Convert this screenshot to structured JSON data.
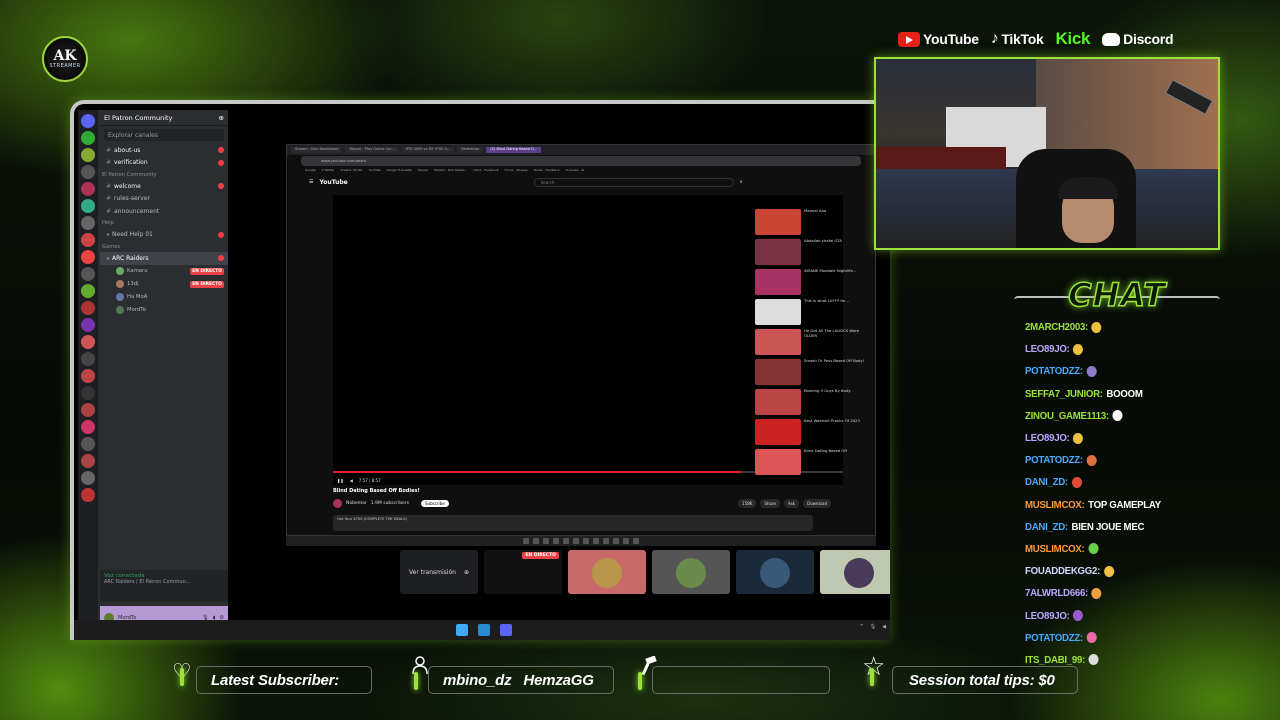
{
  "logo": {
    "mark": "AK",
    "sub": "STREAMER"
  },
  "socials": [
    {
      "name": "YouTube",
      "icon": "youtube-icon"
    },
    {
      "name": "TikTok",
      "icon": "tiktok-icon"
    },
    {
      "name": "Kick",
      "icon": "kick-icon"
    },
    {
      "name": "Discord",
      "icon": "discord-icon"
    }
  ],
  "discord": {
    "server_name": "El Patron Community",
    "search_placeholder": "Explorar canales",
    "channels": [
      {
        "label": "about-us",
        "badge": true,
        "bold": true
      },
      {
        "label": "verification",
        "badge": true,
        "bold": true
      }
    ],
    "category_community": "El Patron Community",
    "community_channels": [
      {
        "label": "welcome",
        "badge": true,
        "bold": true
      },
      {
        "label": "rules-server",
        "badge": false,
        "bold": false
      },
      {
        "label": "announcement",
        "badge": false,
        "bold": false
      }
    ],
    "category_help": "Help",
    "help_channels": [
      {
        "label": "Need Help 01",
        "badge": true
      }
    ],
    "category_games": "Games",
    "game_channel": "ARC Raiders",
    "voice_users": [
      {
        "name": "Kamaru",
        "live": "EN DIRECTO"
      },
      {
        "name": "13dj",
        "live": "EN DIRECTO"
      },
      {
        "name": "Ha MoA",
        "live": ""
      },
      {
        "name": "MordTo",
        "live": ""
      }
    ],
    "voice_connected": "Voz conectada",
    "voice_location": "ARC Raiders / El Patron Commun...",
    "username": "MordTo"
  },
  "browser": {
    "tabs": [
      "Stream - Kick Dashboard",
      "Rayuel - Play Online Cur...",
      "RTX 4090 vs RX 9700 X...",
      "Redirector",
      "(1) Blind Dating Based O..."
    ],
    "active_tab": 4,
    "url": "www.youtube.com/watch",
    "bookmarks": [
      "Google",
      "K Twitter",
      "Creator Studio",
      "YouTube",
      "Google Translate",
      "Rayuel",
      "Stream - Kick Dashb...",
      "Inbox - Facebook",
      "Home - Shopee",
      "Home - Feedback",
      "Surprise - AI"
    ],
    "yt_logo": "YouTube",
    "search_placeholder": "Search",
    "time": "7:57 / 8:57",
    "progress_fraction": 0.8,
    "video_title": "Blind Dating Based Off Bodies!",
    "channel": "Nobemar",
    "subscribers": "1.9M subscribers",
    "subscribe": "Subscribe",
    "actions": [
      "158K",
      "Share",
      "Ask",
      "Download"
    ],
    "description": "Get Your $750 (COMPLETE THE DEALS)",
    "recommendations": [
      {
        "title": "Manual Ana",
        "color": "#c43"
      },
      {
        "title": "Abdallah chafai GTA",
        "color": "#734"
      },
      {
        "title": "INSANE Modable Nightlife...",
        "color": "#a36"
      },
      {
        "title": "This is what LUFFY fm...",
        "color": "#ddd"
      },
      {
        "title": "He Got All The LAUGCS Wore OLDER",
        "color": "#c55"
      },
      {
        "title": "Smash Or Pass Based Off Body!",
        "color": "#833"
      },
      {
        "title": "Ranking 5 Guys By Body",
        "color": "#b44"
      },
      {
        "title": "Best Walmart Pranks Of 2023",
        "color": "#c22"
      },
      {
        "title": "Blind Dating Based Off",
        "color": "#d55"
      }
    ]
  },
  "strip": {
    "watch_label": "Ver transmisión",
    "live_label": "EN DIRECTO"
  },
  "chat": {
    "title": "CHAT",
    "messages": [
      {
        "user": "2MARCH2003:",
        "text": "",
        "color": "#9be33a",
        "emoji": "#f0c040"
      },
      {
        "user": "LEO89JO:",
        "text": "",
        "color": "#b9a6ff",
        "emoji": "#f0c040"
      },
      {
        "user": "POTATODZZ:",
        "text": "",
        "color": "#4aa8ff",
        "emoji": "#8a7cc8"
      },
      {
        "user": "SEFFA7_JUNIOR:",
        "text": "BOOOM",
        "color": "#9be33a",
        "emoji": ""
      },
      {
        "user": "ZINOU_GAME1113:",
        "text": "",
        "color": "#9be33a",
        "emoji": "#ffffff"
      },
      {
        "user": "LEO89JO:",
        "text": "",
        "color": "#b9a6ff",
        "emoji": "#f0c040"
      },
      {
        "user": "POTATODZZ:",
        "text": "",
        "color": "#4aa8ff",
        "emoji": "#e07040"
      },
      {
        "user": "DANI_ZD:",
        "text": "",
        "color": "#4aa8ff",
        "emoji": "#e04a3a"
      },
      {
        "user": "MUSLIMCOX:",
        "text": "TOP GAMEPLAY",
        "color": "#ff9a3a",
        "emoji": ""
      },
      {
        "user": "DANI_ZD:",
        "text": "BIEN JOUE MEC",
        "color": "#4aa8ff",
        "emoji": ""
      },
      {
        "user": "MUSLIMCOX:",
        "text": "",
        "color": "#ff9a3a",
        "emoji": "#6ad04a"
      },
      {
        "user": "FOUADDEKGG2:",
        "text": "",
        "color": "#cfd8ff",
        "emoji": "#f0c040"
      },
      {
        "user": "7ALWRLD666:",
        "text": "",
        "color": "#b9a6ff",
        "emoji": "#f0a040"
      },
      {
        "user": "LEO89JO:",
        "text": "",
        "color": "#b9a6ff",
        "emoji": "#9a5ad0"
      },
      {
        "user": "POTATODZZ:",
        "text": "",
        "color": "#4aa8ff",
        "emoji": "#e86aa8"
      },
      {
        "user": "ITS_DABI_99:",
        "text": "",
        "color": "#9be33a",
        "emoji": "#dddddd"
      }
    ]
  },
  "bottom": {
    "latest_subscriber": "Latest Subscriber:",
    "follower1": "mbino_dz",
    "follower2": "HemzaGG",
    "tips": "Session total tips: $0"
  },
  "colors": {
    "accent": "#9be33a",
    "live": "#ed4245",
    "yt_red": "#e62117"
  }
}
